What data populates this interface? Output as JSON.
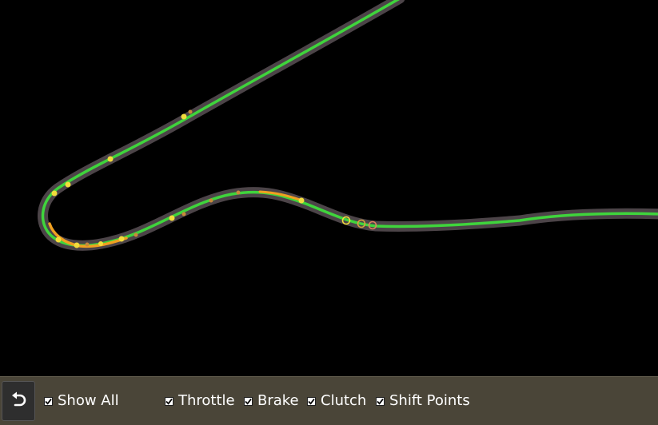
{
  "toolbar": {
    "reset_icon": "undo-arrow-icon",
    "show_all_label": "Show All",
    "show_all_checked": true,
    "throttle_label": "Throttle",
    "throttle_checked": true,
    "brake_label": "Brake",
    "brake_checked": true,
    "clutch_label": "Clutch",
    "clutch_checked": true,
    "shift_points_label": "Shift Points",
    "shift_points_checked": true
  },
  "colors": {
    "track_outline": "#4c4448",
    "throttle": "#3fd43c",
    "brake": "#f0a020",
    "shift_point": "#f2dc3c",
    "toolbar_bg": "#4a4538",
    "background": "#000000"
  }
}
